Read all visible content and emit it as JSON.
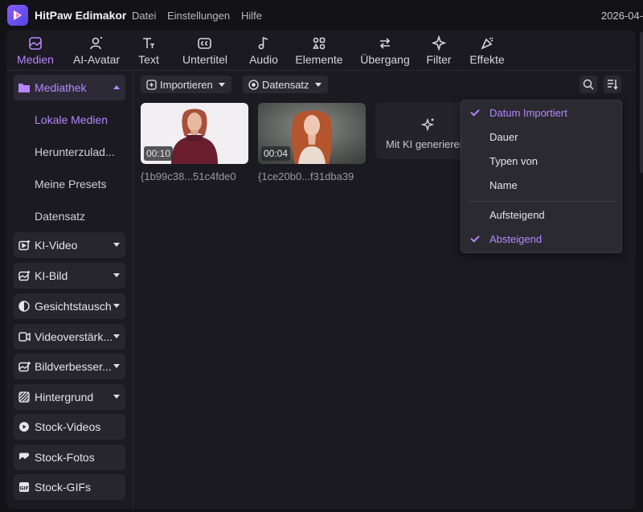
{
  "app": {
    "title": "HitPaw Edimakor",
    "date": "2026-04-"
  },
  "menu": [
    "Datei",
    "Einstellungen",
    "Hilfe"
  ],
  "toolbar": {
    "tools": [
      {
        "label": "Medien",
        "icon": "media-icon",
        "active": true
      },
      {
        "label": "AI-Avatar",
        "icon": "avatar-icon"
      },
      {
        "label": "Text",
        "icon": "text-icon"
      },
      {
        "label": "Untertitel",
        "icon": "subtitle-icon"
      },
      {
        "label": "Audio",
        "icon": "audio-icon"
      },
      {
        "label": "Elemente",
        "icon": "elements-icon"
      },
      {
        "label": "Übergang",
        "icon": "transition-icon"
      },
      {
        "label": "Filter",
        "icon": "filter-icon"
      },
      {
        "label": "Effekte",
        "icon": "effects-icon"
      }
    ]
  },
  "sidebar": {
    "mediathek": {
      "label": "Mediathek",
      "items": [
        "Lokale Medien",
        "Herunterzulad...",
        "Meine Presets",
        "Datensatz"
      ]
    },
    "categories": [
      {
        "label": "KI-Video",
        "icon": "ai-video-icon",
        "expandable": true
      },
      {
        "label": "KI-Bild",
        "icon": "ai-image-icon",
        "expandable": true
      },
      {
        "label": "Gesichtstausch",
        "icon": "face-swap-icon",
        "expandable": true
      },
      {
        "label": "Videoverstärk...",
        "icon": "video-enhance-icon",
        "expandable": true
      },
      {
        "label": "Bildverbesser...",
        "icon": "image-enhance-icon",
        "expandable": true
      },
      {
        "label": "Hintergrund",
        "icon": "background-icon",
        "expandable": true
      },
      {
        "label": "Stock-Videos",
        "icon": "stock-video-icon",
        "expandable": false
      },
      {
        "label": "Stock-Fotos",
        "icon": "stock-photo-icon",
        "expandable": false
      },
      {
        "label": "Stock-GIFs",
        "icon": "stock-gif-icon",
        "expandable": false
      }
    ]
  },
  "content": {
    "import_label": "Importieren",
    "dataset_label": "Datensatz",
    "media": [
      {
        "duration": "00:10",
        "filename": "{1b99c38...51c4fde0"
      },
      {
        "duration": "00:04",
        "filename": "{1ce20b0...f31dba39"
      }
    ],
    "generate_label": "Mit KI generieren"
  },
  "sort_menu": {
    "fields": [
      {
        "label": "Datum Importiert",
        "checked": true
      },
      {
        "label": "Dauer",
        "checked": false
      },
      {
        "label": "Typen von",
        "checked": false
      },
      {
        "label": "Name",
        "checked": false
      }
    ],
    "orders": [
      {
        "label": "Aufsteigend",
        "checked": false
      },
      {
        "label": "Absteigend",
        "checked": true
      }
    ]
  },
  "colors": {
    "accent": "#b786ff",
    "background": "#131217",
    "panel": "#1b1a21"
  }
}
